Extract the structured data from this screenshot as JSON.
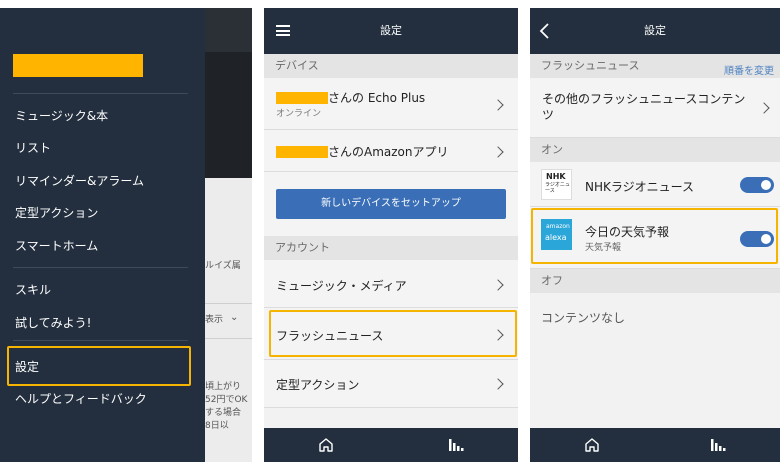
{
  "colors": {
    "bar": "#232f3e",
    "accent": "#ffb400",
    "highlight": "#f4b400",
    "link": "#4f83c2",
    "button": "#3a6fb8"
  },
  "panel1": {
    "background_fragments": [
      "ルイズ属",
      "表示",
      "頃上がり",
      "52円でOK",
      "する場合",
      "8日以"
    ],
    "menu": [
      "ミュージック&本",
      "リスト",
      "リマインダー&アラーム",
      "定型アクション",
      "スマートホーム",
      "スキル",
      "試してみよう!",
      "設定",
      "ヘルプとフィードバック"
    ]
  },
  "panel2": {
    "title": "設定",
    "sections": {
      "devices": "デバイス",
      "account": "アカウント"
    },
    "devices": [
      {
        "suffix": "さんの Echo Plus",
        "status": "オンライン"
      },
      {
        "suffix": "さんのAmazonアプリ",
        "status": ""
      }
    ],
    "setup_button": "新しいデバイスをセットアップ",
    "account_items": [
      "ミュージック・メディア",
      "フラッシュニュース",
      "定型アクション"
    ],
    "icons": [
      "home-icon",
      "bars-icon",
      "menu-icon"
    ]
  },
  "panel3": {
    "title": "設定",
    "header": "フラッシュニュース",
    "reorder": "順番を変更",
    "other": "その他のフラッシュニュースコンテンツ",
    "on_label": "オン",
    "on_items": [
      {
        "title": "NHKラジオニュース",
        "sub": "",
        "logo": "NHK",
        "logo_sub": "ラジオニュース",
        "toggle": true
      },
      {
        "title": "今日の天気予報",
        "sub": "天気予報",
        "logo": "amazon",
        "logo_sub": "alexa",
        "toggle": true
      }
    ],
    "off_label": "オフ",
    "off_empty": "コンテンツなし"
  }
}
